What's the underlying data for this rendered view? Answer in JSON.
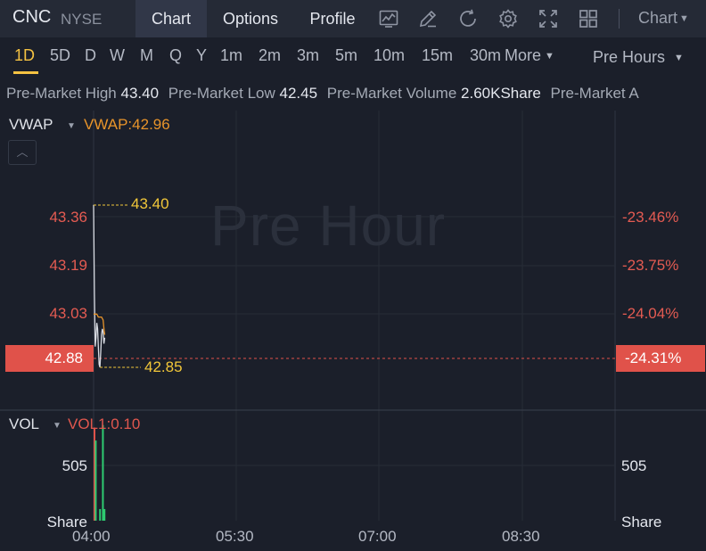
{
  "header": {
    "ticker": "CNC",
    "exchange": "NYSE",
    "tabs": [
      {
        "label": "Chart",
        "active": true
      },
      {
        "label": "Options",
        "active": false
      },
      {
        "label": "Profile",
        "active": false
      }
    ],
    "tools": [
      "chart-type-icon",
      "draw-pen-icon",
      "refresh-icon",
      "settings-gear-icon",
      "fullscreen-icon",
      "layout-grid-icon"
    ],
    "chart_menu_label": "Chart"
  },
  "periods": {
    "items": [
      "1D",
      "5D",
      "D",
      "W",
      "M",
      "Q",
      "Y",
      "1m",
      "2m",
      "3m",
      "5m",
      "10m",
      "15m",
      "30m"
    ],
    "active": "1D",
    "more_label": "More",
    "session_label": "Pre Hours"
  },
  "stats": {
    "high_label": "Pre-Market High",
    "high_value": "43.40",
    "low_label": "Pre-Market Low",
    "low_value": "42.45",
    "volume_label": "Pre-Market Volume",
    "volume_value": "2.60KShare",
    "amount_label": "Pre-Market A"
  },
  "indicators": {
    "main_name": "VWAP",
    "main_value": "VWAP:42.96",
    "vol_name": "VOL",
    "vol_value": "VOL1:0.10"
  },
  "watermark": "Pre Hour",
  "colors": {
    "up": "#2ecc71",
    "down": "#e0524a",
    "vwap": "#e8942a",
    "highlight": "#f2c739",
    "background": "#1b1f2a"
  },
  "chart_data": {
    "type": "line",
    "x_ticks": [
      "04:00",
      "05:30",
      "07:00",
      "08:30"
    ],
    "price_axis": [
      {
        "price": "43.36",
        "pct": "-23.46%"
      },
      {
        "price": "43.19",
        "pct": "-23.75%"
      },
      {
        "price": "43.03",
        "pct": "-24.04%"
      }
    ],
    "current_price": "42.88",
    "current_pct": "-24.31%",
    "high_marker": "43.40",
    "low_marker": "42.85",
    "ylim": [
      42.75,
      43.55
    ],
    "price_series": {
      "minutes": [
        0,
        0.5,
        1,
        1.5,
        2,
        2.5,
        3,
        3.5,
        4,
        4.5,
        5,
        5.5,
        6,
        6.5,
        7
      ],
      "values": [
        43.4,
        43.1,
        42.92,
        42.95,
        43.0,
        42.98,
        42.92,
        42.86,
        42.85,
        42.9,
        42.96,
        42.98,
        42.97,
        42.93,
        42.95
      ]
    },
    "vwap_series": {
      "minutes": [
        0,
        1,
        2,
        3,
        4,
        5,
        6,
        6.5,
        7
      ],
      "values": [
        43.03,
        43.03,
        43.03,
        43.02,
        43.02,
        43.02,
        43.01,
        42.98,
        42.96
      ]
    },
    "volume": {
      "axis_label": "505",
      "unit": "Share",
      "max": 800,
      "bars": [
        {
          "minute": 0,
          "value": 720,
          "dir": "down"
        },
        {
          "minute": 0.8,
          "value": 620,
          "dir": "up"
        },
        {
          "minute": 3.5,
          "value": 90,
          "dir": "up"
        },
        {
          "minute": 5.3,
          "value": 740,
          "dir": "up"
        },
        {
          "minute": 6.3,
          "value": 90,
          "dir": "up"
        }
      ]
    }
  }
}
